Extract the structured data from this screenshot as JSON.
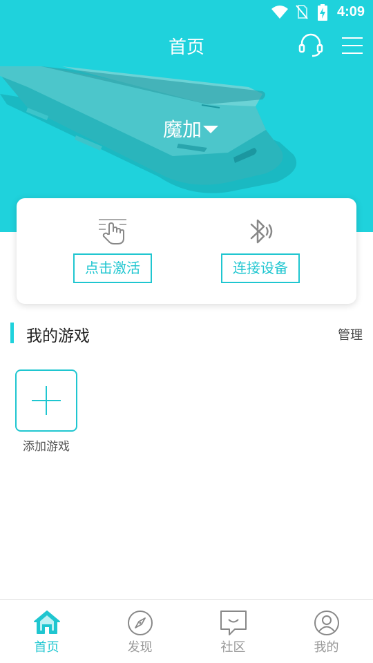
{
  "status_bar": {
    "time": "4:09",
    "icons": [
      "wifi-icon",
      "no-sim-icon",
      "battery-charging-icon"
    ]
  },
  "header": {
    "title": "首页",
    "icons": [
      "headset-icon",
      "menu-icon"
    ]
  },
  "hero": {
    "device_name": "魔加"
  },
  "actions": [
    {
      "label": "点击激活",
      "icon": "tap-icon"
    },
    {
      "label": "连接设备",
      "icon": "bluetooth-icon"
    }
  ],
  "games": {
    "title": "我的游戏",
    "manage_label": "管理",
    "add_label": "添加游戏"
  },
  "tabs": [
    {
      "label": "首页",
      "icon": "home-icon",
      "active": true
    },
    {
      "label": "发现",
      "icon": "compass-icon",
      "active": false
    },
    {
      "label": "社区",
      "icon": "chat-icon",
      "active": false
    },
    {
      "label": "我的",
      "icon": "profile-icon",
      "active": false
    }
  ],
  "colors": {
    "accent": "#1fd2dc",
    "accent_text": "#1fc6d0",
    "inactive": "#999999"
  }
}
